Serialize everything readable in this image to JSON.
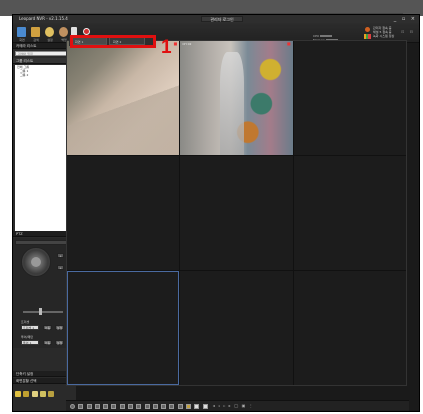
{
  "window": {
    "app_title": "Leopard NVR - v2.1.15.4",
    "center_title": "관리자 로그인",
    "controls": "_ ▫ ×"
  },
  "toolbar": {
    "items": [
      {
        "label": "화면",
        "icon": "monitor-icon",
        "color": "#4a8ad0"
      },
      {
        "label": "검색",
        "icon": "search-db-icon",
        "color": "#d0a040"
      },
      {
        "label": "설정",
        "icon": "settings-icon",
        "color": "#e0c060"
      },
      {
        "label": "백업",
        "icon": "backup-icon",
        "color": "#c09060"
      },
      {
        "label": "로그",
        "icon": "log-icon",
        "color": "#e0e0e0"
      },
      {
        "label": "",
        "icon": "record-icon",
        "color": "#d03030"
      }
    ]
  },
  "status": {
    "cpu_label": "CPU",
    "mem_label": "Memory",
    "net_label": "Network"
  },
  "user": {
    "line1": "관리자 접속 중",
    "line2": "채널 5 접속 중",
    "line3": "녹화 시스템 정상"
  },
  "left_panel": {
    "camera_list_title": "카메라 리스트",
    "search_placeholder": "검색어 입력",
    "tree_root": "그룹 리스트",
    "tree_items": [
      "전체 그룹",
      "그룹 1",
      "그룹 2"
    ],
    "ptz_title": "PTZ",
    "zoom_in": "+",
    "zoom_out": "−",
    "focus_near": "+",
    "focus_far": "−",
    "preset_label": "프리셋",
    "preset_value": "프리셋 1",
    "tour_label": "투어/패턴",
    "tour_value": "투어 1",
    "go_label": "이동",
    "set_label": "설정",
    "bottom_head1": "단축키 설정",
    "bottom_head2": "화면분할 선택"
  },
  "tabs": {
    "tab1": "화면 1",
    "tab2": "화면 2"
  },
  "callout": {
    "number": "1",
    "color": "#e01010"
  },
  "cameras": [
    {
      "label": "",
      "has_video": true
    },
    {
      "label": "CH 02",
      "has_video": true
    },
    {
      "label": "",
      "has_video": false
    },
    {
      "label": "",
      "has_video": false
    },
    {
      "label": "",
      "has_video": false
    },
    {
      "label": "",
      "has_video": false
    },
    {
      "label": "",
      "has_video": false,
      "selected": true
    },
    {
      "label": "",
      "has_video": false
    },
    {
      "label": "",
      "has_video": false
    }
  ]
}
